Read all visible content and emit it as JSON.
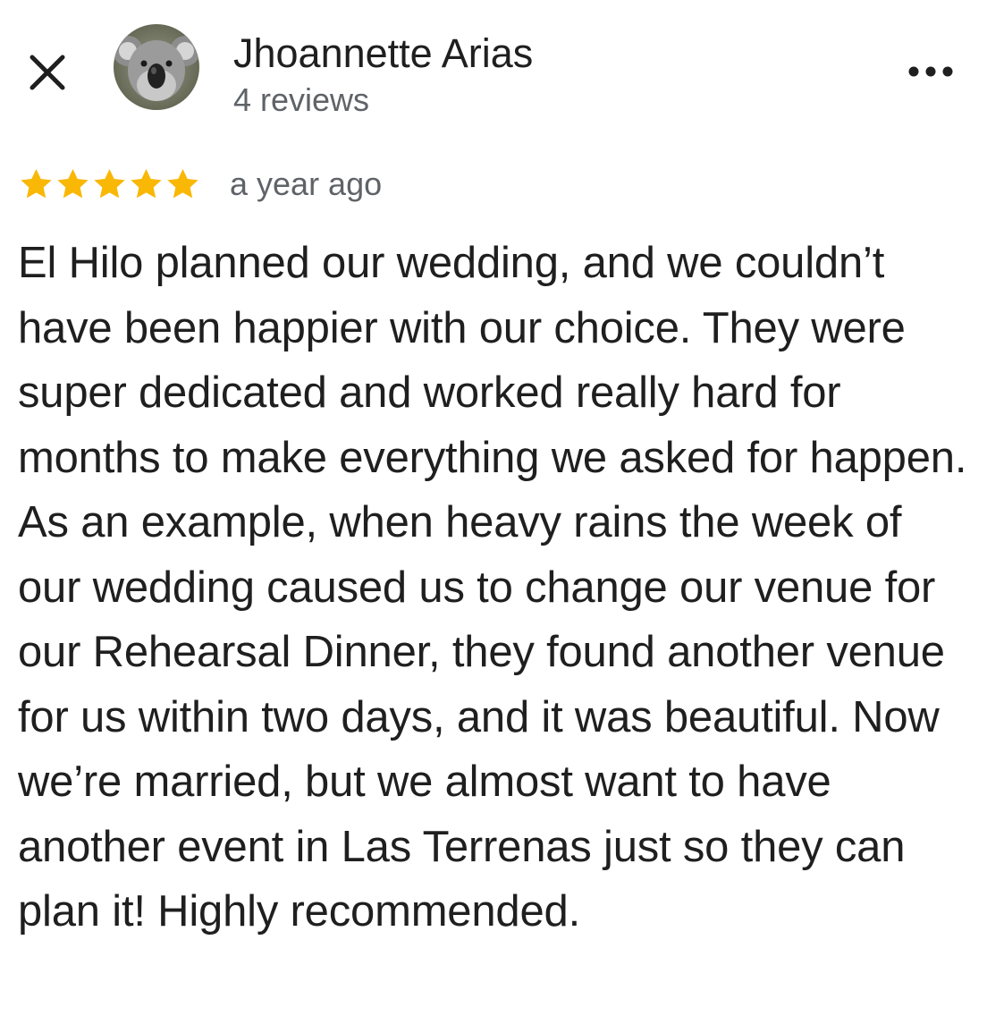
{
  "header": {
    "close_icon": "close-icon",
    "avatar_icon": "koala-avatar",
    "author_name": "Jhoannette Arias",
    "review_count": "4 reviews",
    "more_icon": "more-horizontal-icon"
  },
  "review": {
    "rating": 5,
    "rating_max": 5,
    "star_color": "#f9b706",
    "time_ago": "a year ago",
    "text": "El Hilo planned our wedding, and we couldn’t have been happier with our choice. They were super dedicated and worked really hard for months to make everything we asked for happen. As an example, when heavy rains the week of our wedding caused us to change our venue for our Rehearsal Dinner, they found another venue for us within two days, and it was beautiful. Now we’re married, but we almost want to have another event in Las Terrenas just so they can plan it! Highly recommended."
  }
}
